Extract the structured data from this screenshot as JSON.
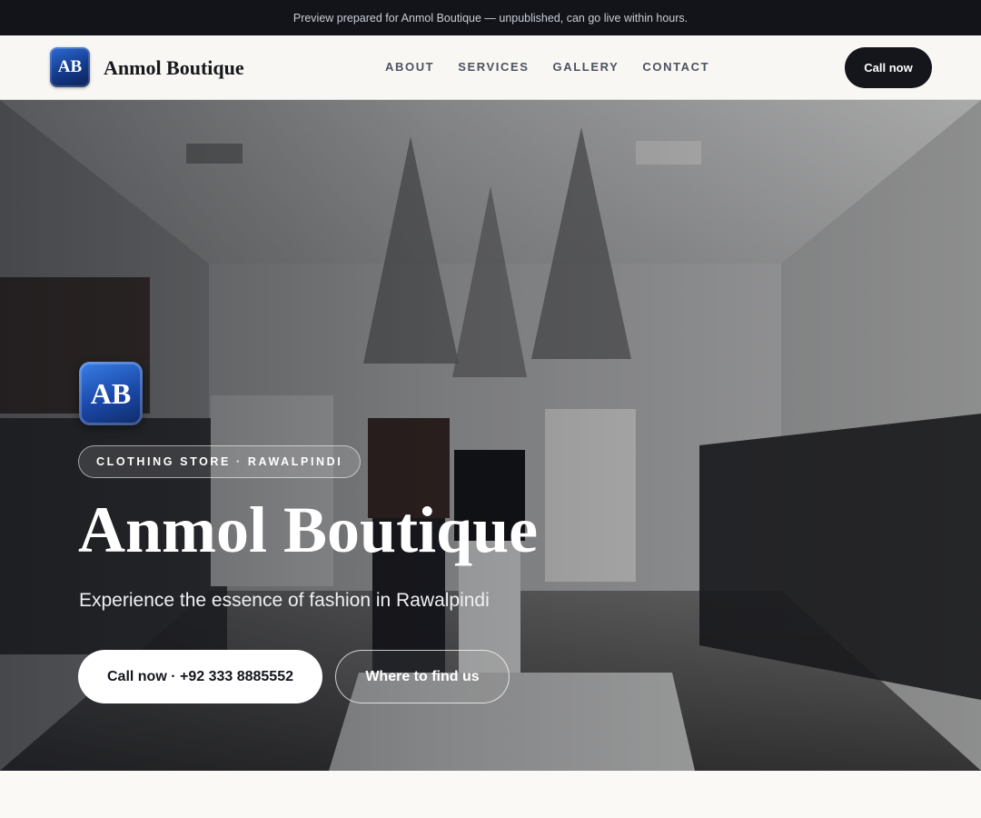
{
  "announcement": "Preview prepared for Anmol Boutique — unpublished, can go live within hours.",
  "header": {
    "logo_initials": "AB",
    "brand": "Anmol Boutique",
    "nav": [
      "ABOUT",
      "SERVICES",
      "GALLERY",
      "CONTACT"
    ],
    "cta": "Call now"
  },
  "hero": {
    "badge_initials": "AB",
    "tagline": "CLOTHING STORE · RAWALPINDI",
    "title": "Anmol Boutique",
    "subtitle": "Experience the essence of fashion in Rawalpindi",
    "primary_button": "Call now · +92 333 8885552",
    "secondary_button": "Where to find us"
  },
  "colors": {
    "accent_blue": "#1a48a8",
    "dark": "#14161c",
    "background": "#faf9f6"
  }
}
